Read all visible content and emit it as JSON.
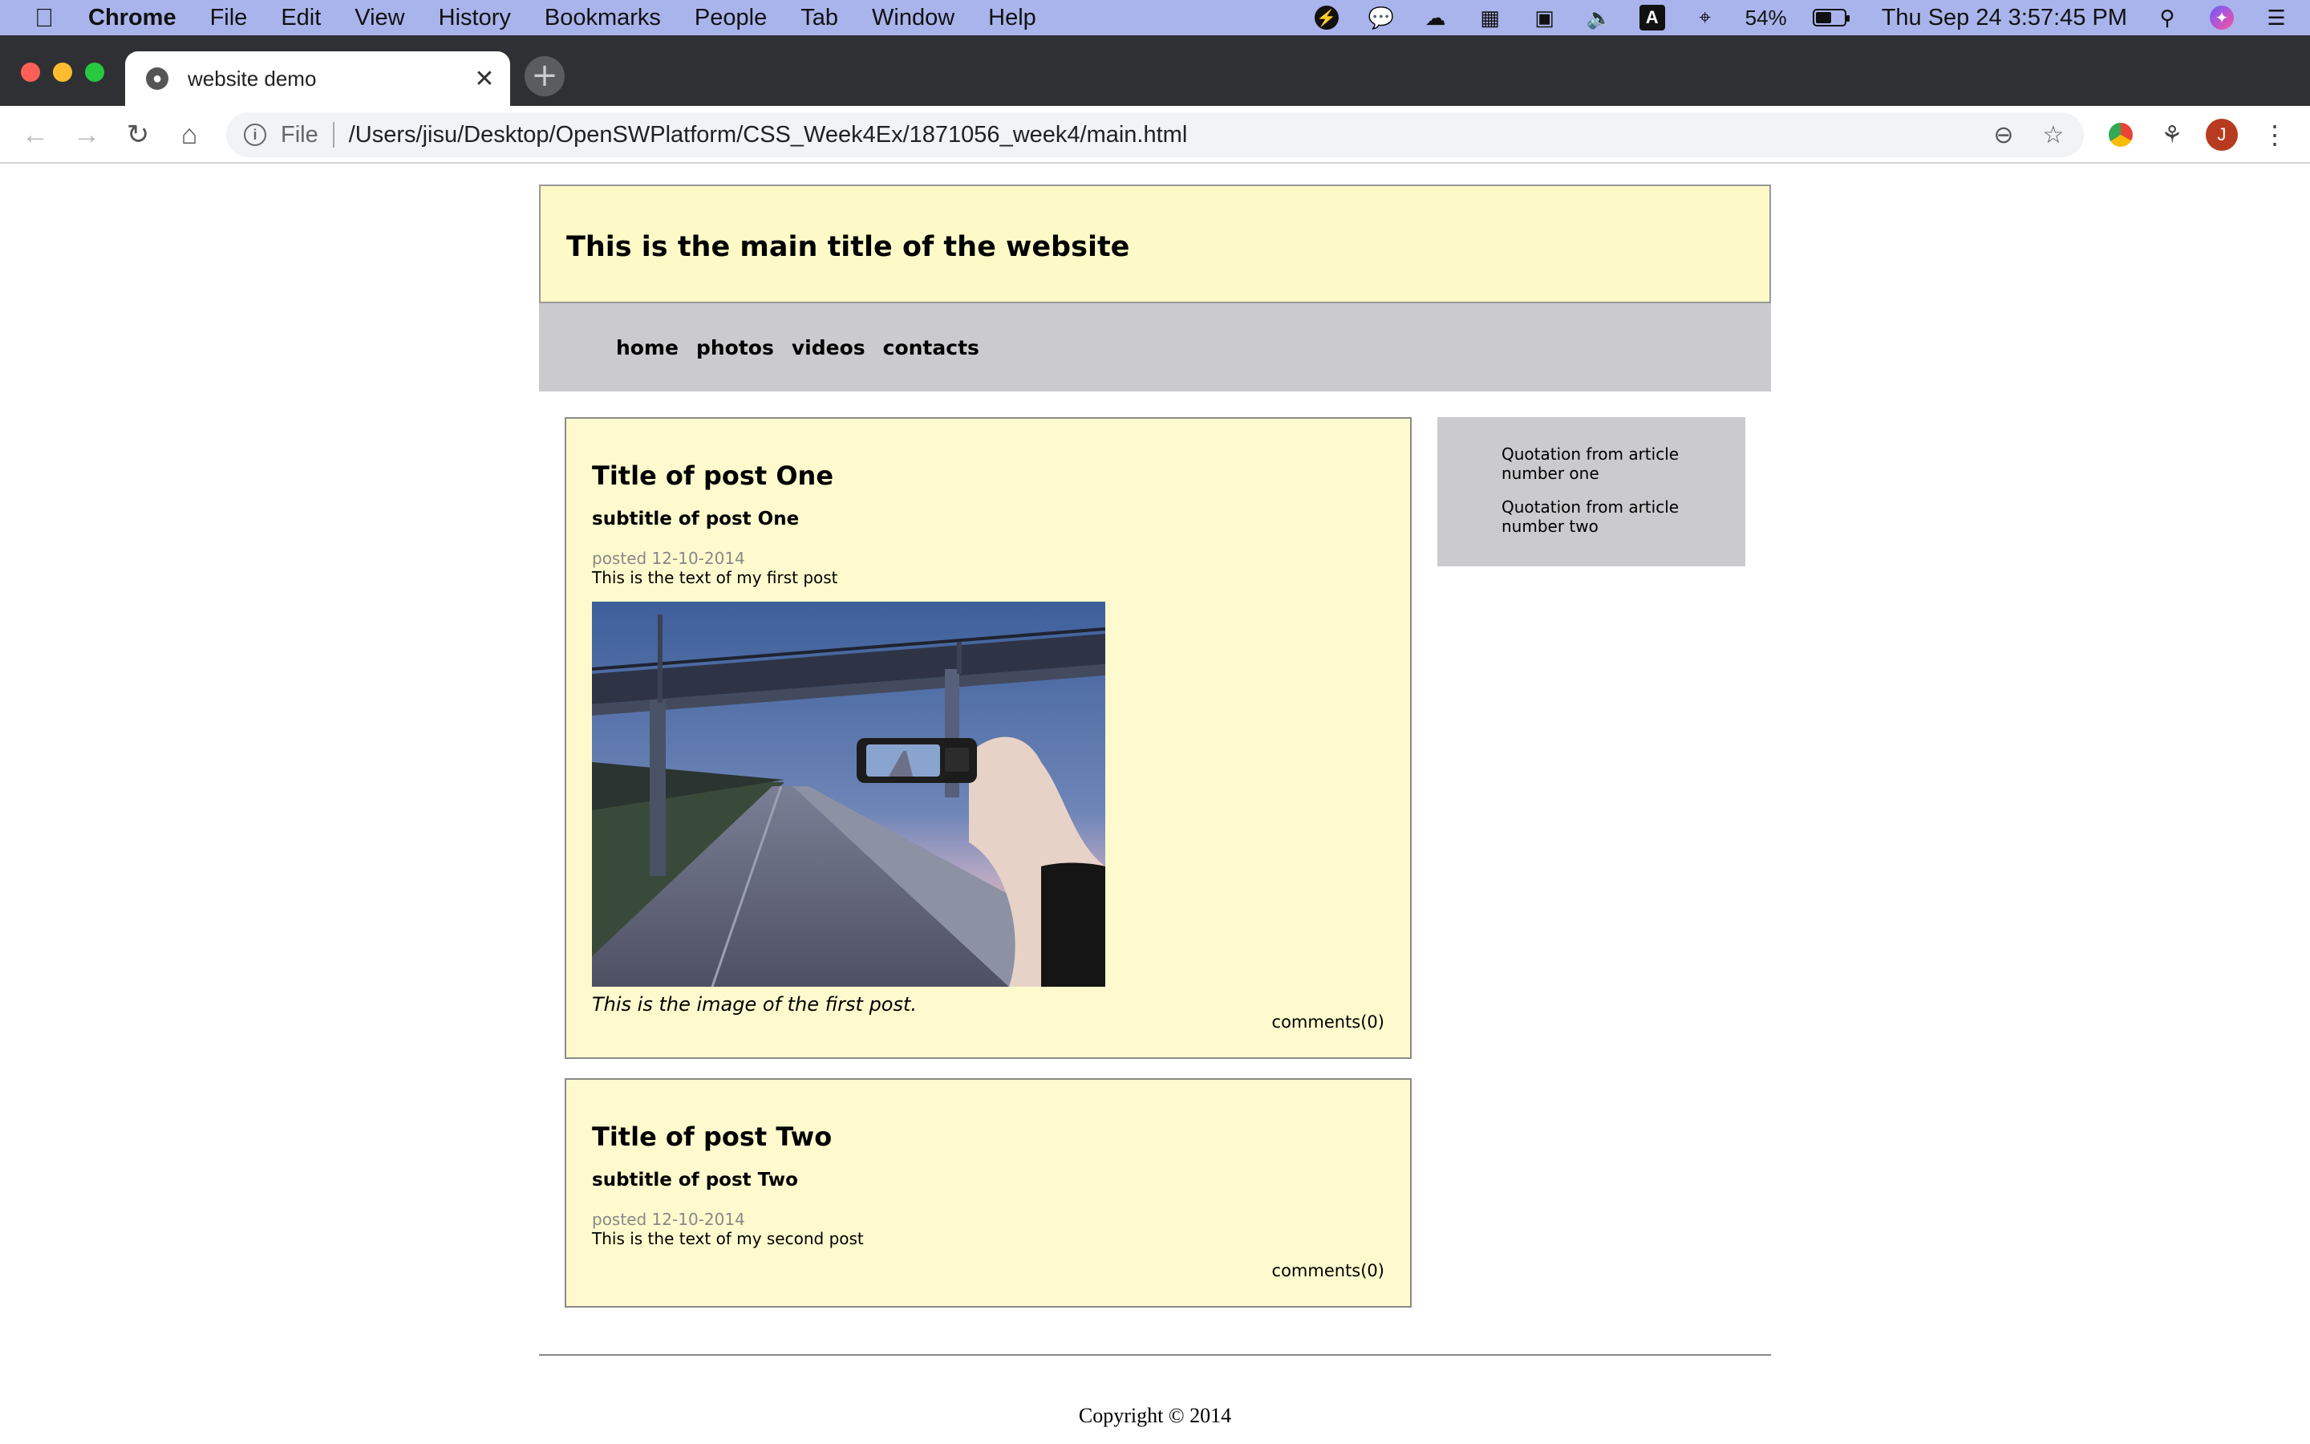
{
  "menubar": {
    "app_name": "Chrome",
    "items": [
      "File",
      "Edit",
      "View",
      "History",
      "Bookmarks",
      "People",
      "Tab",
      "Window",
      "Help"
    ],
    "battery_percent": "54%",
    "datetime": "Thu Sep 24  3:57:45 PM",
    "input_source": "A"
  },
  "browser": {
    "tab_title": "website demo",
    "scheme_label": "File",
    "url": "/Users/jisu/Desktop/OpenSWPlatform/CSS_Week4Ex/1871056_week4/main.html",
    "profile_initial": "J"
  },
  "site": {
    "main_title": "This is the main title of the website",
    "nav": [
      "home",
      "photos",
      "videos",
      "contacts"
    ]
  },
  "posts": [
    {
      "title": "Title of post One",
      "subtitle": "subtitle of post One",
      "date": "posted 12-10-2014",
      "text": "This is the text of my first post",
      "image_caption": "This is the image of the first post.",
      "comments": "comments(0)"
    },
    {
      "title": "Title of post Two",
      "subtitle": "subtitle of post Two",
      "date": "posted 12-10-2014",
      "text": "This is the text of my second post",
      "comments": "comments(0)"
    }
  ],
  "sidebar": {
    "quotes": [
      "Quotation from article number one",
      "Quotation from article number two"
    ]
  },
  "footer": {
    "copyright": "Copyright © 2014"
  },
  "colors": {
    "header_bg": "#fefac8",
    "nav_bg": "#cbcbcd",
    "post_bg": "#fefacd",
    "menubar_bg": "#a9b4ec"
  }
}
